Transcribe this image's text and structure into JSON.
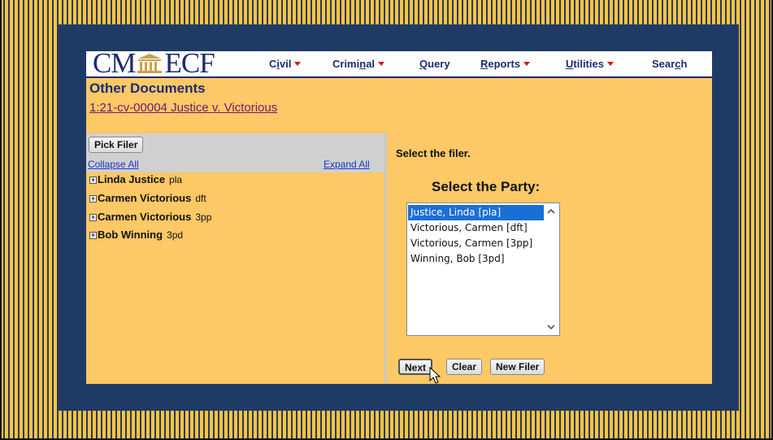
{
  "header": {
    "logo_left": "CM",
    "logo_right": "ECF",
    "menu": [
      {
        "label": "Civil",
        "underline": "i"
      },
      {
        "label": "Criminal",
        "underline": "n"
      },
      {
        "label": "Query"
      },
      {
        "label": "Reports"
      },
      {
        "label": "Utilities"
      },
      {
        "label": "Search"
      }
    ],
    "menu_labels": {
      "civil_pre": "C",
      "civil_u": "i",
      "civil_post": "vil",
      "criminal_pre": "Crimi",
      "criminal_u": "n",
      "criminal_post": "al",
      "query_u": "Q",
      "query_post": "uery",
      "reports_u": "R",
      "reports_post": "eports",
      "utilities_u": "U",
      "utilities_post": "tilities",
      "search_pre": "Sear",
      "search_u": "c",
      "search_post": "h"
    }
  },
  "page": {
    "title": "Other Documents",
    "case_link": "1:21-cv-00004 Justice v. Victorious"
  },
  "left_panel": {
    "pick_filer_button": "Pick Filer",
    "collapse_all": "Collapse All",
    "expand_all": "Expand All",
    "parties": [
      {
        "name": "Linda Justice",
        "role": "pla"
      },
      {
        "name": "Carmen Victorious",
        "role": "dft"
      },
      {
        "name": "Carmen Victorious",
        "role": "3pp"
      },
      {
        "name": "Bob Winning",
        "role": "3pd"
      }
    ]
  },
  "right_panel": {
    "instruction": "Select the filer.",
    "party_title": "Select the Party:",
    "options": [
      "Justice, Linda [pla]",
      "Victorious, Carmen [dft]",
      "Victorious, Carmen [3pp]",
      "Winning, Bob [3pd]"
    ],
    "selected_index": 0,
    "buttons": {
      "next": "Next",
      "clear": "Clear",
      "new_filer": "New Filer"
    }
  },
  "colors": {
    "background_yellow": "#fcc43c",
    "frame_navy": "#203a66",
    "panel_tan": "#fdc866",
    "header_text": "#1c2b73",
    "menu_caret": "#d2160e",
    "selection_blue": "#1a6fd6"
  }
}
